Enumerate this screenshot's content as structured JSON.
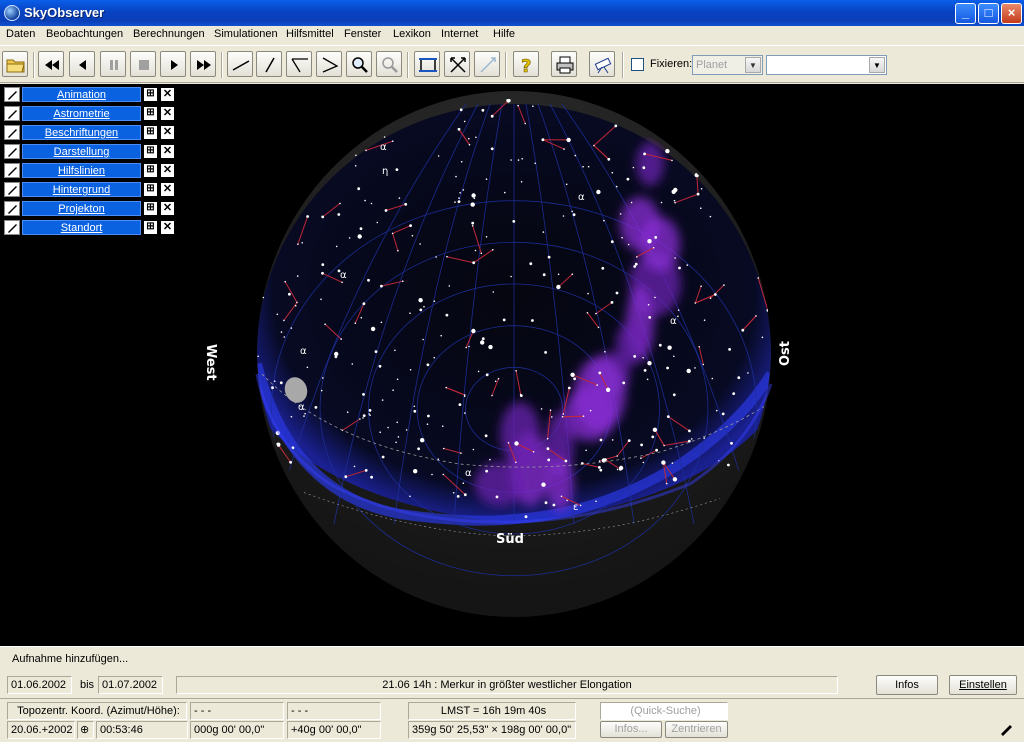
{
  "window": {
    "title": "SkyObserver"
  },
  "menu": [
    "Daten",
    "Beobachtungen",
    "Berechnungen",
    "Simulationen",
    "Hilfsmittel",
    "Fenster",
    "Lexikon",
    "Internet",
    "Hilfe"
  ],
  "toolbar": {
    "fix_label": "Fixieren:",
    "planet_value": "Planet",
    "object_value": ""
  },
  "panels": [
    "Animation",
    "Astrometrie",
    "Beschriftungen",
    "Darstellung",
    "Hilfslinien",
    "Hintergrund",
    "Projekton",
    "Standort"
  ],
  "compass": {
    "west": "West",
    "south": "Süd",
    "east": "Ost"
  },
  "star_labels": [
    "α",
    "α",
    "α",
    "α",
    "α",
    "α",
    "ε",
    "α",
    "η"
  ],
  "record": {
    "add_label": "Aufnahme hinzufügen..."
  },
  "dates": {
    "from": "01.06.2002",
    "to_label": "bis",
    "to": "01.07.2002",
    "event": "21.06  14h :  Merkur in größter westlicher Elongation",
    "infos_button": "Infos",
    "settings_button": "Einstellen"
  },
  "coords": {
    "system_label": "Topozentr. Koord. (Azimut/Höhe):",
    "field1": "- - -",
    "field2": "- - -",
    "date": "20.06.+2002",
    "time": "00:53:46",
    "azimuth": "000g 00' 00,0\"",
    "altitude": "+40g 00' 00,0\"",
    "lmst": "LMST = 16h 19m 40s",
    "fov": "359g 50' 25,53\" × 198g 00' 00,0\"",
    "quick_search": "(Quick-Suche)",
    "infos_button": "Infos...",
    "center_button": "Zentrieren"
  },
  "colors": {
    "titlebar": "#0a4fd0",
    "panel": "#0a62e0",
    "sky": "#000000",
    "milkyway": "#8a2fd6",
    "constellation": "#c0283a",
    "grid": "#1e2f9c"
  }
}
